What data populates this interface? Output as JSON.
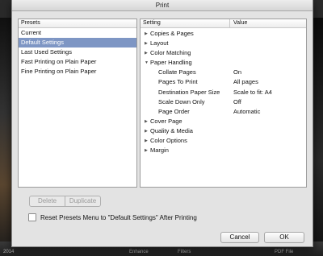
{
  "window": {
    "title": "Print"
  },
  "presets": {
    "header": "Presets",
    "items": [
      {
        "label": "Current",
        "selected": false
      },
      {
        "label": "Default Settings",
        "selected": true
      },
      {
        "label": "Last Used Settings",
        "selected": false
      },
      {
        "label": "Fast Printing on Plain Paper",
        "selected": false
      },
      {
        "label": "Fine Printing on Plain Paper",
        "selected": false
      }
    ],
    "delete_label": "Delete",
    "duplicate_label": "Duplicate"
  },
  "settings": {
    "col_setting": "Setting",
    "col_value": "Value",
    "rows": [
      {
        "label": "Copies & Pages",
        "expanded": false
      },
      {
        "label": "Layout",
        "expanded": false
      },
      {
        "label": "Color Matching",
        "expanded": false
      },
      {
        "label": "Paper Handling",
        "expanded": true
      },
      {
        "label": "Collate Pages",
        "value": "On",
        "child": true
      },
      {
        "label": "Pages To Print",
        "value": "All pages",
        "child": true
      },
      {
        "label": "Destination Paper Size",
        "value": "Scale to fit: A4",
        "child": true
      },
      {
        "label": "Scale Down Only",
        "value": "Off",
        "child": true
      },
      {
        "label": "Page Order",
        "value": "Automatic",
        "child": true
      },
      {
        "label": "Cover Page",
        "expanded": false
      },
      {
        "label": "Quality & Media",
        "expanded": false
      },
      {
        "label": "Color Options",
        "expanded": false
      },
      {
        "label": "Margin",
        "expanded": false
      }
    ]
  },
  "reset_checkbox_label": "Reset Presets Menu to \"Default Settings\" After Printing",
  "buttons": {
    "cancel": "Cancel",
    "ok": "OK"
  },
  "background": {
    "bottom_text_left": "2014",
    "bottom_items": [
      "Enhance",
      "Filters",
      "PDF File"
    ]
  }
}
